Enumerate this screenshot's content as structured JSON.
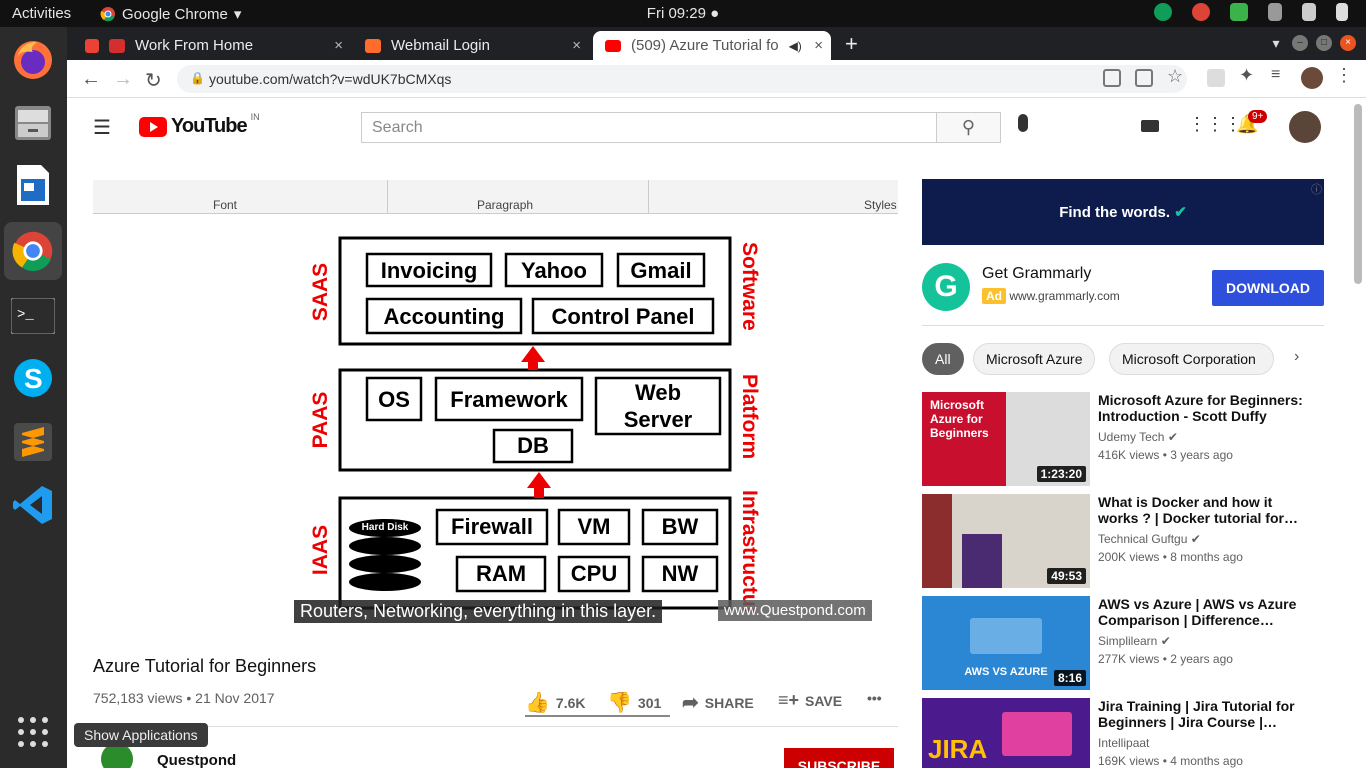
{
  "topbar": {
    "activities": "Activities",
    "app": "Google Chrome",
    "clock": "Fri 09:29"
  },
  "tabs": [
    {
      "label": "Work From Home",
      "close": "×"
    },
    {
      "label": "Webmail Login",
      "close": "×"
    },
    {
      "label": "(509) Azure Tutorial fo",
      "close": "×"
    }
  ],
  "newtab": "+",
  "address": {
    "url": "youtube.com/watch?v=wdUK7bCMXqs"
  },
  "youtube": {
    "logo": "YouTube",
    "region": "IN",
    "search_placeholder": "Search",
    "notifications": "9+"
  },
  "video": {
    "ribbon_font": "Font",
    "ribbon_paragraph": "Paragraph",
    "ribbon_styles": "Styles",
    "subtitle": "Routers, Networking, everything in this layer.",
    "watermark": "www.Questpond.com",
    "title": "Azure Tutorial for Beginners",
    "meta": "752,183 views • 21 Nov 2017",
    "likes": "7.6K",
    "dislikes": "301",
    "share": "SHARE",
    "save": "SAVE",
    "more": "•••",
    "channel": "Questpond",
    "subscribe": "SUBSCRIBE"
  },
  "diagram": {
    "saas_label": "SAAS",
    "saas_side": "Software",
    "paas_label": "PAAS",
    "paas_side": "Platform",
    "iaas_label": "IAAS",
    "iaas_side": "Infrastructur",
    "saas_items": [
      "Invoicing",
      "Yahoo",
      "Gmail",
      "Accounting",
      "Control Panel"
    ],
    "paas_items": [
      "OS",
      "Framework",
      "Web",
      "Server",
      "DB"
    ],
    "iaas_items": [
      "Hard Disk",
      "Firewall",
      "VM",
      "BW",
      "RAM",
      "CPU",
      "NW"
    ]
  },
  "tooltip": "Show Applications",
  "ad": {
    "banner": "Find the words.",
    "name": "Get Grammarly",
    "badge": "Ad",
    "domain": "www.grammarly.com",
    "cta": "DOWNLOAD"
  },
  "chips": [
    "All",
    "Microsoft Azure",
    "Microsoft Corporation"
  ],
  "recommendations": [
    {
      "title": "Microsoft Azure for Beginners: Introduction - Scott Duffy",
      "channel": "Udemy Tech",
      "views": "416K views • 3 years ago",
      "duration": "1:23:20",
      "thumb_text": "Microsoft Azure for Beginners"
    },
    {
      "title": "What is Docker and how it works ? | Docker tutorial for…",
      "channel": "Technical Guftgu",
      "views": "200K views • 8 months ago",
      "duration": "49:53",
      "thumb_text": ""
    },
    {
      "title": "AWS vs Azure | AWS vs Azure Comparison | Difference…",
      "channel": "Simplilearn",
      "views": "277K views • 2 years ago",
      "duration": "8:16",
      "thumb_text": "AWS VS AZURE"
    },
    {
      "title": "Jira Training | Jira Tutorial for Beginners | Jira Course |…",
      "channel": "Intellipaat",
      "views": "169K views • 4 months ago",
      "duration": "",
      "thumb_text": "JIRA"
    }
  ]
}
